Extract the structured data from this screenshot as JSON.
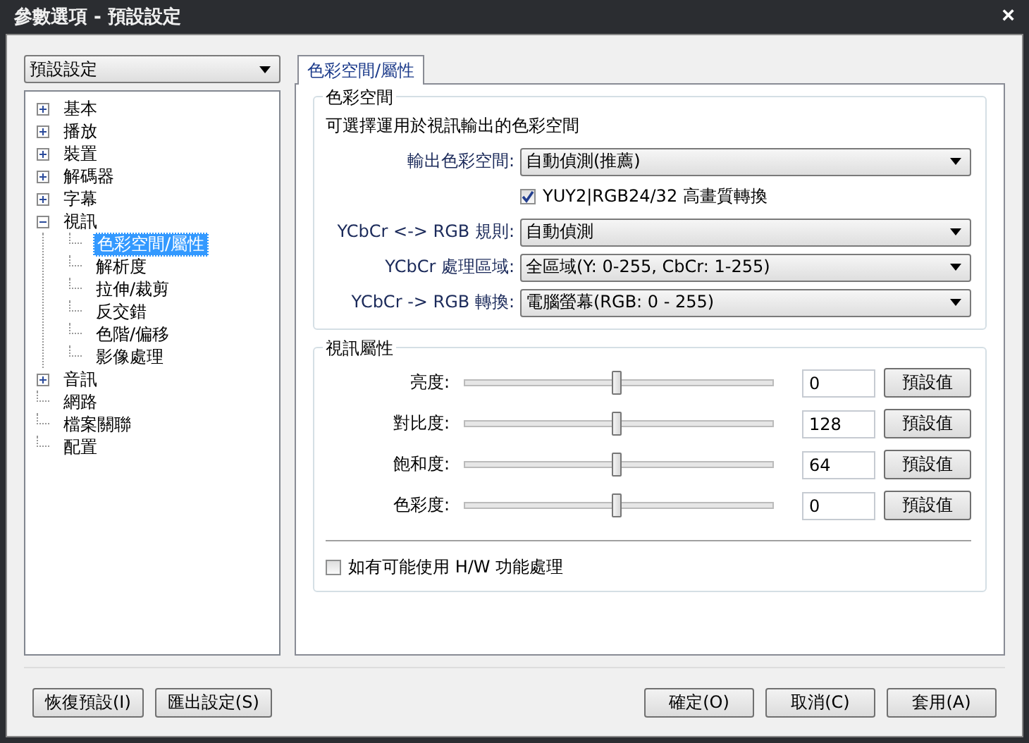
{
  "window": {
    "title": "參數選項 - 預設設定",
    "close": "×"
  },
  "preset_combo": {
    "value": "預設設定"
  },
  "tree": [
    {
      "label": "基本",
      "expanded": false,
      "selected": false
    },
    {
      "label": "播放",
      "expanded": false,
      "selected": false
    },
    {
      "label": "裝置",
      "expanded": false,
      "selected": false
    },
    {
      "label": "解碼器",
      "expanded": false,
      "selected": false
    },
    {
      "label": "字幕",
      "expanded": false,
      "selected": false
    },
    {
      "label": "視訊",
      "expanded": true,
      "selected": false,
      "children": [
        {
          "label": "色彩空間/屬性",
          "selected": true
        },
        {
          "label": "解析度",
          "selected": false
        },
        {
          "label": "拉伸/裁剪",
          "selected": false
        },
        {
          "label": "反交錯",
          "selected": false
        },
        {
          "label": "色階/偏移",
          "selected": false
        },
        {
          "label": "影像處理",
          "selected": false
        }
      ]
    },
    {
      "label": "音訊",
      "expanded": false,
      "selected": false
    },
    {
      "label": "網路",
      "selected": false
    },
    {
      "label": "檔案關聯",
      "selected": false
    },
    {
      "label": "配置",
      "selected": false
    }
  ],
  "tab": {
    "label": "色彩空間/屬性",
    "selected": true
  },
  "color_space": {
    "title": "色彩空間",
    "description": "可選擇運用於視訊輸出的色彩空間",
    "rows": [
      {
        "kind": "combo",
        "label": "輸出色彩空間:",
        "value": "自動偵測(推薦)"
      },
      {
        "kind": "checkbox",
        "label": "YUY2|RGB24/32 高畫質轉換",
        "checked": true
      },
      {
        "kind": "combo",
        "label": "YCbCr <-> RGB 規則:",
        "value": "自動偵測"
      },
      {
        "kind": "combo",
        "label": "YCbCr 處理區域:",
        "value": "全區域(Y: 0-255, CbCr: 1-255)"
      },
      {
        "kind": "combo",
        "label": "YCbCr -> RGB 轉換:",
        "value": "電腦螢幕(RGB: 0 - 255)"
      }
    ]
  },
  "video_properties": {
    "title": "視訊屬性",
    "sliders": [
      {
        "label": "亮度:",
        "level": 0.49,
        "value": "0",
        "button": "預設值"
      },
      {
        "label": "對比度:",
        "level": 0.49,
        "value": "128",
        "button": "預設值"
      },
      {
        "label": "飽和度:",
        "level": 0.49,
        "value": "64",
        "button": "預設值"
      },
      {
        "label": "色彩度:",
        "level": 0.49,
        "value": "0",
        "button": "預設值"
      }
    ],
    "hw_checkbox": {
      "label": "如有可能使用 H/W 功能處理",
      "checked": false
    }
  },
  "buttons_left": [
    "恢復預設(I)",
    "匯出設定(S)"
  ],
  "buttons_right": [
    "確定(O)",
    "取消(C)",
    "套用(A)"
  ]
}
